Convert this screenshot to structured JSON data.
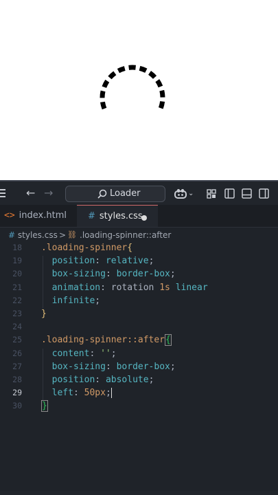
{
  "preview": {
    "spinner": "dashed-circle-arc"
  },
  "titlebar": {
    "search_label": "Loader",
    "icons": [
      "menu-icon",
      "back-arrow-icon",
      "forward-arrow-icon",
      "search-icon",
      "copilot-icon",
      "chevron-down-icon",
      "layout-icon",
      "sidebar-left-icon",
      "panel-bottom-icon",
      "sidebar-right-icon"
    ]
  },
  "tabs": [
    {
      "icon": "<>",
      "label": "index.html",
      "active": false
    },
    {
      "icon": "#",
      "label": "styles.css",
      "active": true,
      "modified": true
    }
  ],
  "breadcrumb": {
    "hash": "#",
    "file": "styles.css",
    "sep": ">",
    "symbol": ".loading-spinner::after"
  },
  "editor": {
    "lines": [
      {
        "n": "18",
        "cur": false
      },
      {
        "n": "19",
        "cur": false
      },
      {
        "n": "20",
        "cur": false
      },
      {
        "n": "21",
        "cur": false
      },
      {
        "n": "22",
        "cur": false
      },
      {
        "n": "23",
        "cur": false
      },
      {
        "n": "24",
        "cur": false
      },
      {
        "n": "25",
        "cur": false
      },
      {
        "n": "26",
        "cur": false
      },
      {
        "n": "27",
        "cur": false
      },
      {
        "n": "28",
        "cur": false
      },
      {
        "n": "29",
        "cur": true
      },
      {
        "n": "30",
        "cur": false
      }
    ],
    "code": {
      "l18_sel": ".loading-spinner",
      "l18_brace": "{",
      "l19_prop": "position",
      "l19_val": "relative",
      "l20_prop": "box-sizing",
      "l20_val": "border-box",
      "l21_prop": "animation",
      "l21_name": "rotation",
      "l21_num": "1",
      "l21_unit": "s",
      "l21_fn": "linear",
      "l22_val": "infinite",
      "l23_brace": "}",
      "l25_sel": ".loading-spinner::after",
      "l25_brace": "{",
      "l26_prop": "content",
      "l26_str": "''",
      "l27_prop": "box-sizing",
      "l27_val": "border-box",
      "l28_prop": "position",
      "l28_val": "absolute",
      "l29_prop": "left",
      "l29_num": "50",
      "l29_unit": "px",
      "l30_brace": "}"
    }
  }
}
